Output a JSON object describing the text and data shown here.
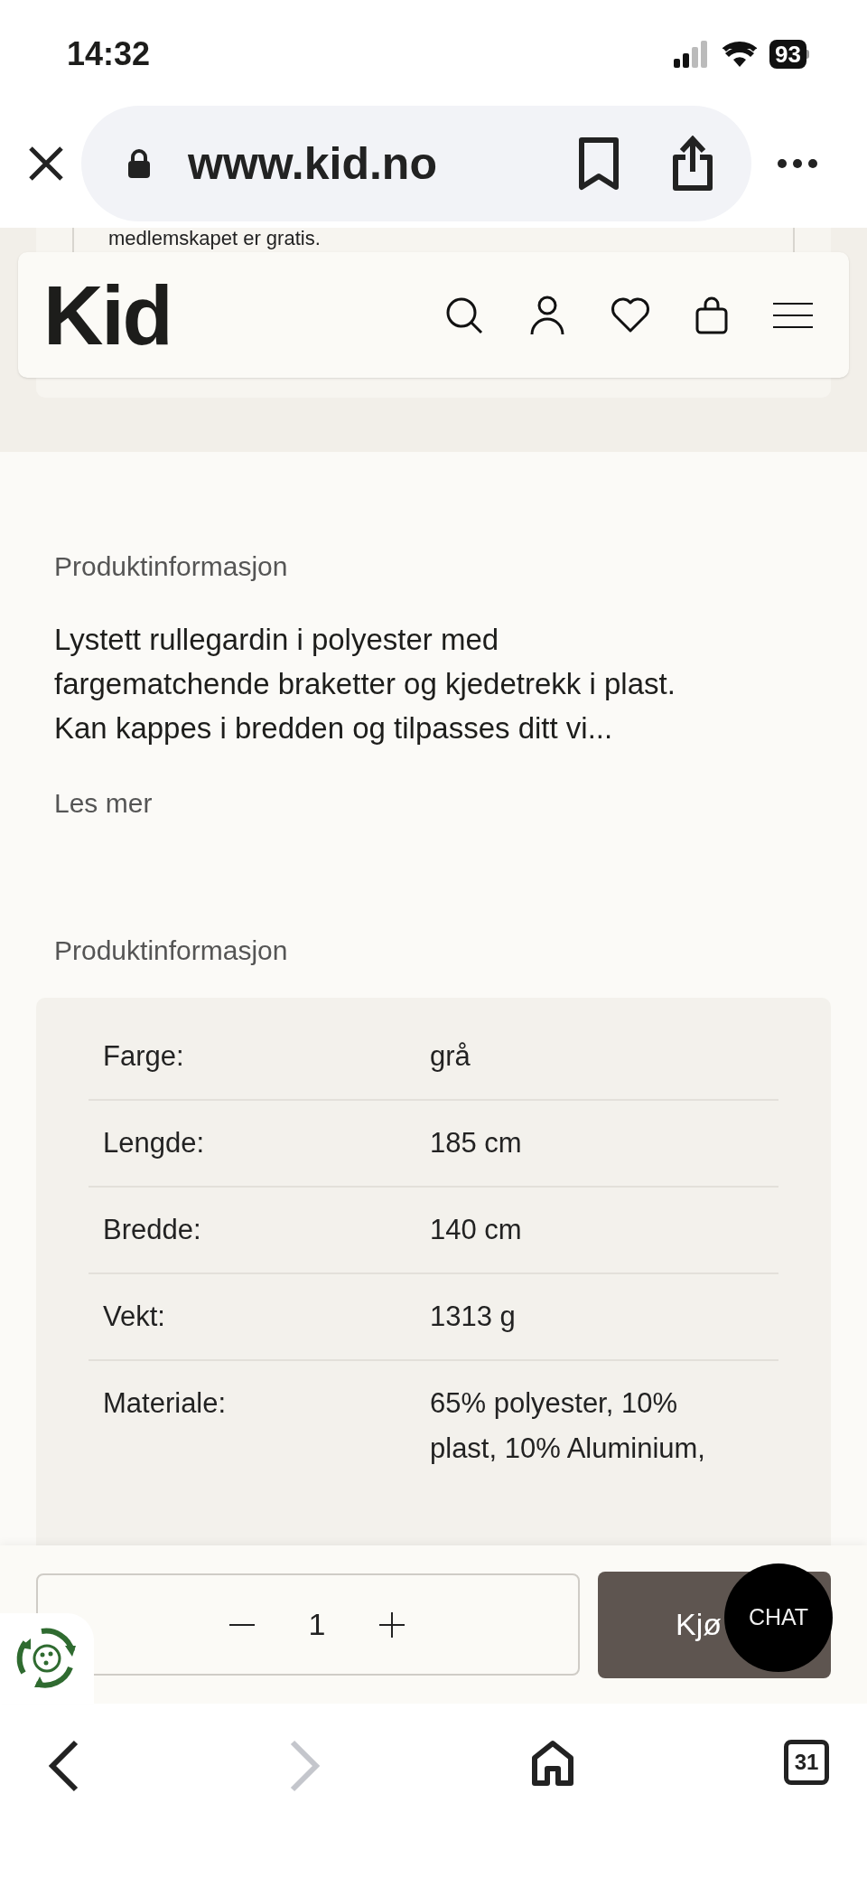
{
  "status_bar": {
    "time": "14:32",
    "battery": "93"
  },
  "browser": {
    "url": "www.kid.no",
    "can_go_forward": false,
    "tabs_count": "31"
  },
  "banner": {
    "text": "medlemskapet er gratis."
  },
  "header": {
    "logo": "Kid"
  },
  "description": {
    "heading": "Produktinformasjon",
    "text": "Lystett rullegardin i polyester med fargematchende braketter og kjedetrekk i plast. Kan kappes i bredden og tilpasses ditt vi...",
    "link": "Les mer"
  },
  "specs": {
    "heading": "Produktinformasjon",
    "rows": [
      {
        "label": "Farge:",
        "value": "grå"
      },
      {
        "label": "Lengde:",
        "value": "185 cm"
      },
      {
        "label": "Bredde:",
        "value": "140 cm"
      },
      {
        "label": "Vekt:",
        "value": "1313 g"
      },
      {
        "label": "Materiale:",
        "value": "65% polyester, 10% plast, 10% Aluminium,"
      }
    ]
  },
  "purchase": {
    "quantity": "1",
    "buy": "Kjø",
    "chat": "CHAT"
  }
}
